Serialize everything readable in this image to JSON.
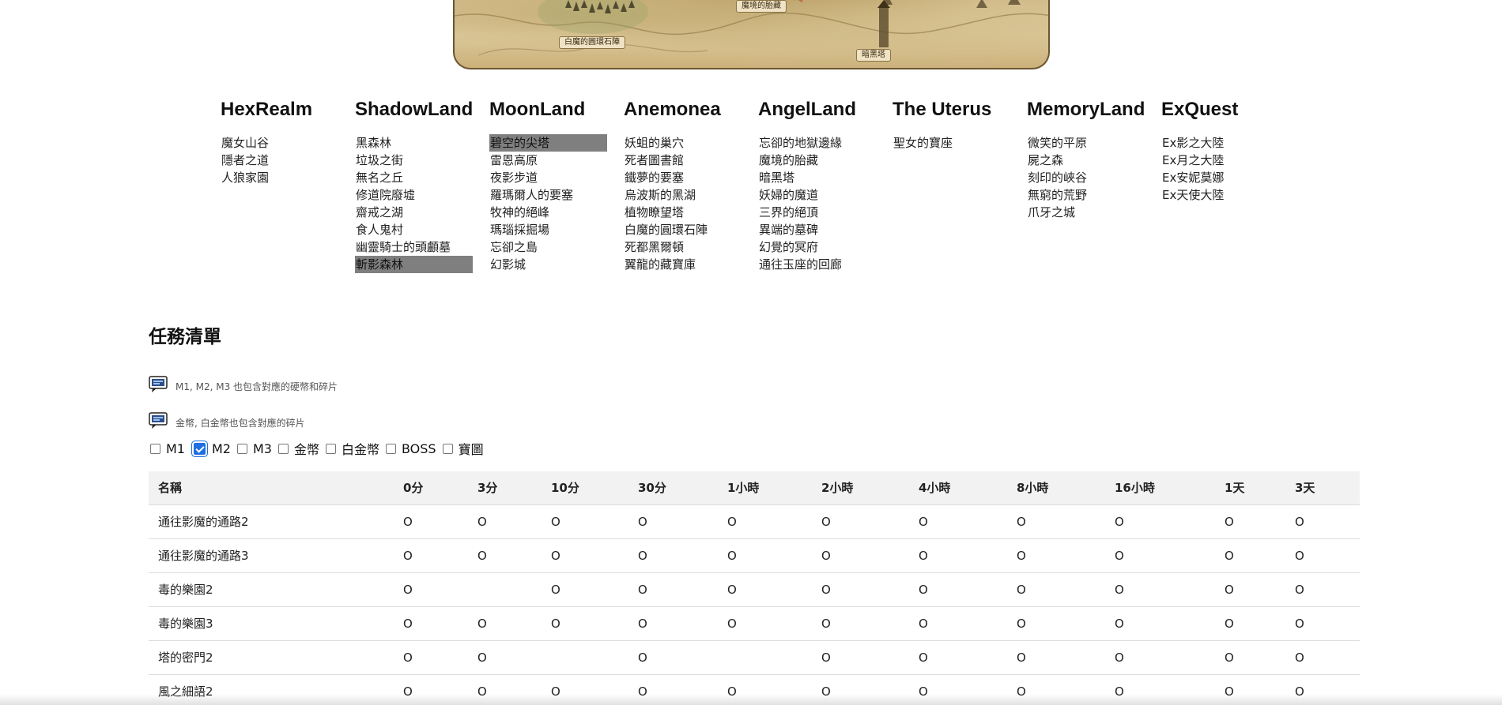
{
  "map": {
    "labels": [
      "白魔的圓環石陣",
      "魔境的胎藏",
      "暗黑塔"
    ]
  },
  "regions": [
    {
      "title": "HexRealm",
      "links": [
        "魔女山谷",
        "隱者之道",
        "人狼家園"
      ]
    },
    {
      "title": "ShadowLand",
      "links": [
        "黑森林",
        "垃圾之街",
        "無名之丘",
        "修道院廢墟",
        "齋戒之湖",
        "食人鬼村",
        "幽靈騎士的頭顱墓",
        "斬影森林"
      ],
      "active": [
        7
      ]
    },
    {
      "title": "MoonLand",
      "links": [
        "碧空的尖塔",
        "雷恩高原",
        "夜影步道",
        "羅瑪爾人的要塞",
        "牧神的絕峰",
        "瑪瑙採掘場",
        "忘卻之島",
        "幻影城"
      ],
      "active": [
        0
      ]
    },
    {
      "title": "Anemonea",
      "links": [
        "妖蛆的巢穴",
        "死者圖書館",
        "鐵夢的要塞",
        "烏波斯的黑湖",
        "植物瞭望塔",
        "白魔的圓環石陣",
        "死都黑爾頓",
        "翼龍的藏寶庫"
      ]
    },
    {
      "title": "AngelLand",
      "links": [
        "忘卻的地獄邊緣",
        "魔境的胎藏",
        "暗黑塔",
        "妖婦的魔道",
        "三界的絕頂",
        "異端的墓碑",
        "幻覺的冥府",
        "通往玉座的回廊"
      ]
    },
    {
      "title": "The Uterus",
      "links": [
        "聖女的寶座"
      ]
    },
    {
      "title": "MemoryLand",
      "links": [
        "微笑的平原",
        "屍之森",
        "刻印的峽谷",
        "無窮的荒野",
        "爪牙之城"
      ]
    },
    {
      "title": "ExQuest",
      "links": [
        "Ex影之大陸",
        "Ex月之大陸",
        "Ex安妮莫娜",
        "Ex天使大陸"
      ]
    }
  ],
  "quest": {
    "title": "任務清單",
    "notes": [
      "M1, M2, M3 也包含對應的硬幣和碎片",
      "金幣, 白金幣也包含對應的碎片"
    ],
    "note_icon": "chat-bubble-icon",
    "filters": [
      {
        "label": "M1",
        "checked": false
      },
      {
        "label": "M2",
        "checked": true
      },
      {
        "label": "M3",
        "checked": false
      },
      {
        "label": "金幣",
        "checked": false
      },
      {
        "label": "白金幣",
        "checked": false
      },
      {
        "label": "BOSS",
        "checked": false
      },
      {
        "label": "寶圖",
        "checked": false
      }
    ],
    "columns": [
      "名稱",
      "0分",
      "3分",
      "10分",
      "30分",
      "1小時",
      "2小時",
      "4小時",
      "8小時",
      "16小時",
      "1天",
      "3天"
    ],
    "rows": [
      {
        "name": "通往影魔的通路2",
        "cells": [
          "O",
          "O",
          "O",
          "O",
          "O",
          "O",
          "O",
          "O",
          "O",
          "O",
          "O"
        ]
      },
      {
        "name": "通往影魔的通路3",
        "cells": [
          "O",
          "O",
          "O",
          "O",
          "O",
          "O",
          "O",
          "O",
          "O",
          "O",
          "O"
        ]
      },
      {
        "name": "毒的樂園2",
        "cells": [
          "O",
          "",
          "O",
          "O",
          "O",
          "O",
          "O",
          "O",
          "O",
          "O",
          "O"
        ]
      },
      {
        "name": "毒的樂園3",
        "cells": [
          "O",
          "O",
          "O",
          "O",
          "O",
          "O",
          "O",
          "O",
          "O",
          "O",
          "O"
        ]
      },
      {
        "name": "塔的密門2",
        "cells": [
          "O",
          "O",
          "",
          "O",
          "",
          "O",
          "O",
          "O",
          "O",
          "O",
          "O"
        ]
      },
      {
        "name": "風之細語2",
        "cells": [
          "O",
          "O",
          "O",
          "O",
          "O",
          "O",
          "O",
          "O",
          "O",
          "O",
          "O"
        ]
      }
    ]
  },
  "colors": {
    "active_link_bg": "#7f7f7f",
    "table_header_bg": "#f2f2f2",
    "checkbox_accent": "#1f6fe0",
    "map_border": "#6b5631"
  }
}
